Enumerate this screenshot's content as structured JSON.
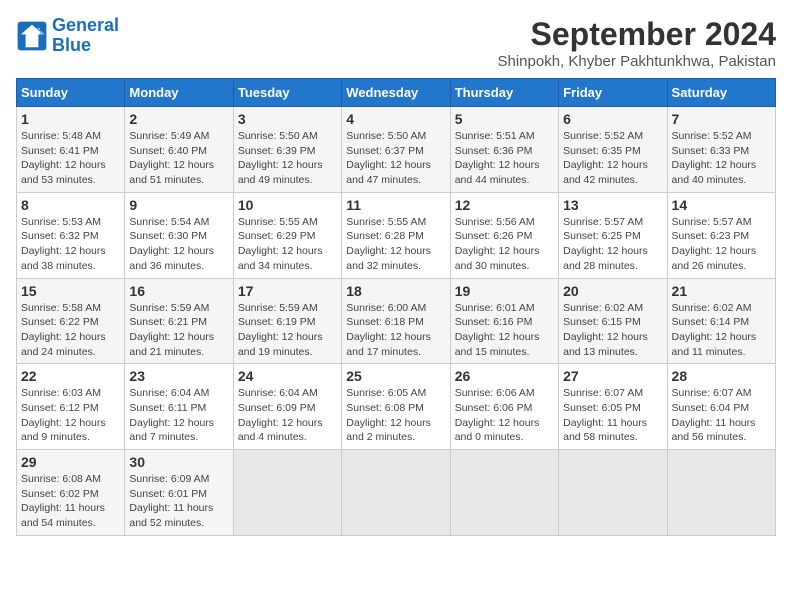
{
  "header": {
    "logo_line1": "General",
    "logo_line2": "Blue",
    "month_year": "September 2024",
    "location": "Shinpokh, Khyber Pakhtunkhwa, Pakistan"
  },
  "weekdays": [
    "Sunday",
    "Monday",
    "Tuesday",
    "Wednesday",
    "Thursday",
    "Friday",
    "Saturday"
  ],
  "weeks": [
    [
      {
        "day": "1",
        "sunrise": "5:48 AM",
        "sunset": "6:41 PM",
        "daylight": "12 hours and 53 minutes."
      },
      {
        "day": "2",
        "sunrise": "5:49 AM",
        "sunset": "6:40 PM",
        "daylight": "12 hours and 51 minutes."
      },
      {
        "day": "3",
        "sunrise": "5:50 AM",
        "sunset": "6:39 PM",
        "daylight": "12 hours and 49 minutes."
      },
      {
        "day": "4",
        "sunrise": "5:50 AM",
        "sunset": "6:37 PM",
        "daylight": "12 hours and 47 minutes."
      },
      {
        "day": "5",
        "sunrise": "5:51 AM",
        "sunset": "6:36 PM",
        "daylight": "12 hours and 44 minutes."
      },
      {
        "day": "6",
        "sunrise": "5:52 AM",
        "sunset": "6:35 PM",
        "daylight": "12 hours and 42 minutes."
      },
      {
        "day": "7",
        "sunrise": "5:52 AM",
        "sunset": "6:33 PM",
        "daylight": "12 hours and 40 minutes."
      }
    ],
    [
      {
        "day": "8",
        "sunrise": "5:53 AM",
        "sunset": "6:32 PM",
        "daylight": "12 hours and 38 minutes."
      },
      {
        "day": "9",
        "sunrise": "5:54 AM",
        "sunset": "6:30 PM",
        "daylight": "12 hours and 36 minutes."
      },
      {
        "day": "10",
        "sunrise": "5:55 AM",
        "sunset": "6:29 PM",
        "daylight": "12 hours and 34 minutes."
      },
      {
        "day": "11",
        "sunrise": "5:55 AM",
        "sunset": "6:28 PM",
        "daylight": "12 hours and 32 minutes."
      },
      {
        "day": "12",
        "sunrise": "5:56 AM",
        "sunset": "6:26 PM",
        "daylight": "12 hours and 30 minutes."
      },
      {
        "day": "13",
        "sunrise": "5:57 AM",
        "sunset": "6:25 PM",
        "daylight": "12 hours and 28 minutes."
      },
      {
        "day": "14",
        "sunrise": "5:57 AM",
        "sunset": "6:23 PM",
        "daylight": "12 hours and 26 minutes."
      }
    ],
    [
      {
        "day": "15",
        "sunrise": "5:58 AM",
        "sunset": "6:22 PM",
        "daylight": "12 hours and 24 minutes."
      },
      {
        "day": "16",
        "sunrise": "5:59 AM",
        "sunset": "6:21 PM",
        "daylight": "12 hours and 21 minutes."
      },
      {
        "day": "17",
        "sunrise": "5:59 AM",
        "sunset": "6:19 PM",
        "daylight": "12 hours and 19 minutes."
      },
      {
        "day": "18",
        "sunrise": "6:00 AM",
        "sunset": "6:18 PM",
        "daylight": "12 hours and 17 minutes."
      },
      {
        "day": "19",
        "sunrise": "6:01 AM",
        "sunset": "6:16 PM",
        "daylight": "12 hours and 15 minutes."
      },
      {
        "day": "20",
        "sunrise": "6:02 AM",
        "sunset": "6:15 PM",
        "daylight": "12 hours and 13 minutes."
      },
      {
        "day": "21",
        "sunrise": "6:02 AM",
        "sunset": "6:14 PM",
        "daylight": "12 hours and 11 minutes."
      }
    ],
    [
      {
        "day": "22",
        "sunrise": "6:03 AM",
        "sunset": "6:12 PM",
        "daylight": "12 hours and 9 minutes."
      },
      {
        "day": "23",
        "sunrise": "6:04 AM",
        "sunset": "6:11 PM",
        "daylight": "12 hours and 7 minutes."
      },
      {
        "day": "24",
        "sunrise": "6:04 AM",
        "sunset": "6:09 PM",
        "daylight": "12 hours and 4 minutes."
      },
      {
        "day": "25",
        "sunrise": "6:05 AM",
        "sunset": "6:08 PM",
        "daylight": "12 hours and 2 minutes."
      },
      {
        "day": "26",
        "sunrise": "6:06 AM",
        "sunset": "6:06 PM",
        "daylight": "12 hours and 0 minutes."
      },
      {
        "day": "27",
        "sunrise": "6:07 AM",
        "sunset": "6:05 PM",
        "daylight": "11 hours and 58 minutes."
      },
      {
        "day": "28",
        "sunrise": "6:07 AM",
        "sunset": "6:04 PM",
        "daylight": "11 hours and 56 minutes."
      }
    ],
    [
      {
        "day": "29",
        "sunrise": "6:08 AM",
        "sunset": "6:02 PM",
        "daylight": "11 hours and 54 minutes."
      },
      {
        "day": "30",
        "sunrise": "6:09 AM",
        "sunset": "6:01 PM",
        "daylight": "11 hours and 52 minutes."
      },
      null,
      null,
      null,
      null,
      null
    ]
  ]
}
